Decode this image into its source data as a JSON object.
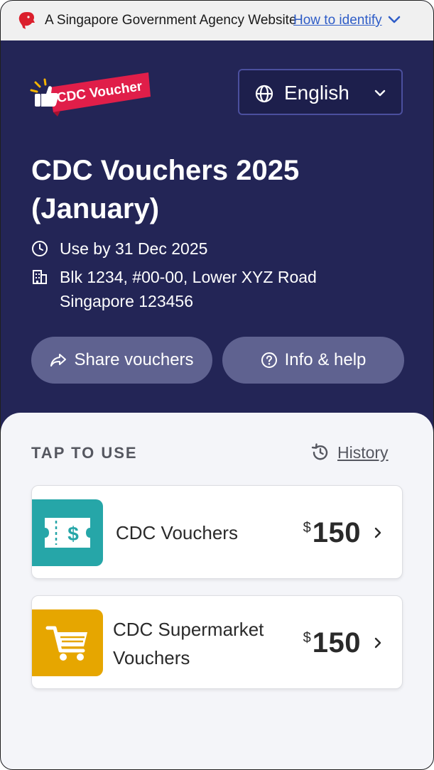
{
  "gov_bar": {
    "text": "A Singapore Government Agency Website",
    "link": "How to identify"
  },
  "header": {
    "logo_text": "CDC Voucher",
    "language": "English",
    "title_line1": "CDC Vouchers 2025",
    "title_line2": "(January)",
    "use_by": "Use by 31 Dec 2025",
    "address_line1": "Blk 1234, #00-00, Lower XYZ Road",
    "address_line2": "Singapore 123456",
    "share_label": "Share vouchers",
    "info_label": "Info & help"
  },
  "content": {
    "section_label": "TAP TO USE",
    "history_label": "History",
    "cards": [
      {
        "label": "CDC Vouchers",
        "currency": "$",
        "amount": "150",
        "color": "#26a6a8"
      },
      {
        "label_line1": "CDC Supermarket",
        "label_line2": "Vouchers",
        "currency": "$",
        "amount": "150",
        "color": "#e6a600"
      }
    ]
  },
  "colors": {
    "header_bg": "#232556",
    "logo_red": "#e01e49",
    "link_blue": "#2f5dc7"
  }
}
